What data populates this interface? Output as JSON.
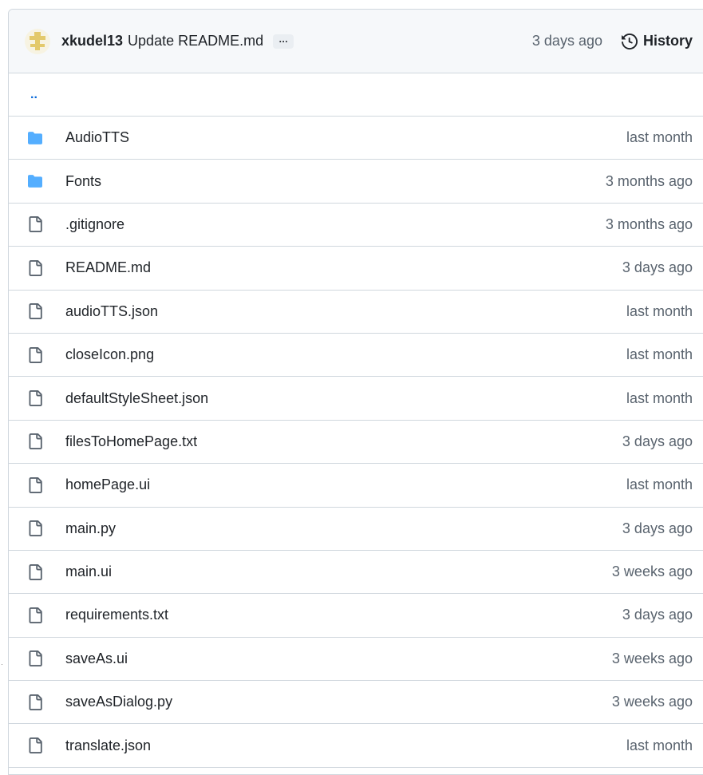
{
  "commit": {
    "author": "xkudel13",
    "message": "Update README.md",
    "ellipsis": "…",
    "date": "3 days ago",
    "history_label": "History"
  },
  "parent_dir": "..",
  "colors": {
    "folder": "#54aeff",
    "link": "#0969da",
    "muted": "#59636e",
    "border": "#d0d7de",
    "header_bg": "#f6f8fa"
  },
  "files": [
    {
      "name": "AudioTTS",
      "type": "folder",
      "date": "last month"
    },
    {
      "name": "Fonts",
      "type": "folder",
      "date": "3 months ago"
    },
    {
      "name": ".gitignore",
      "type": "file",
      "date": "3 months ago"
    },
    {
      "name": "README.md",
      "type": "file",
      "date": "3 days ago"
    },
    {
      "name": "audioTTS.json",
      "type": "file",
      "date": "last month"
    },
    {
      "name": "closeIcon.png",
      "type": "file",
      "date": "last month"
    },
    {
      "name": "defaultStyleSheet.json",
      "type": "file",
      "date": "last month"
    },
    {
      "name": "filesToHomePage.txt",
      "type": "file",
      "date": "3 days ago"
    },
    {
      "name": "homePage.ui",
      "type": "file",
      "date": "last month"
    },
    {
      "name": "main.py",
      "type": "file",
      "date": "3 days ago"
    },
    {
      "name": "main.ui",
      "type": "file",
      "date": "3 weeks ago"
    },
    {
      "name": "requirements.txt",
      "type": "file",
      "date": "3 days ago"
    },
    {
      "name": "saveAs.ui",
      "type": "file",
      "date": "3 weeks ago"
    },
    {
      "name": "saveAsDialog.py",
      "type": "file",
      "date": "3 weeks ago"
    },
    {
      "name": "translate.json",
      "type": "file",
      "date": "last month"
    }
  ]
}
